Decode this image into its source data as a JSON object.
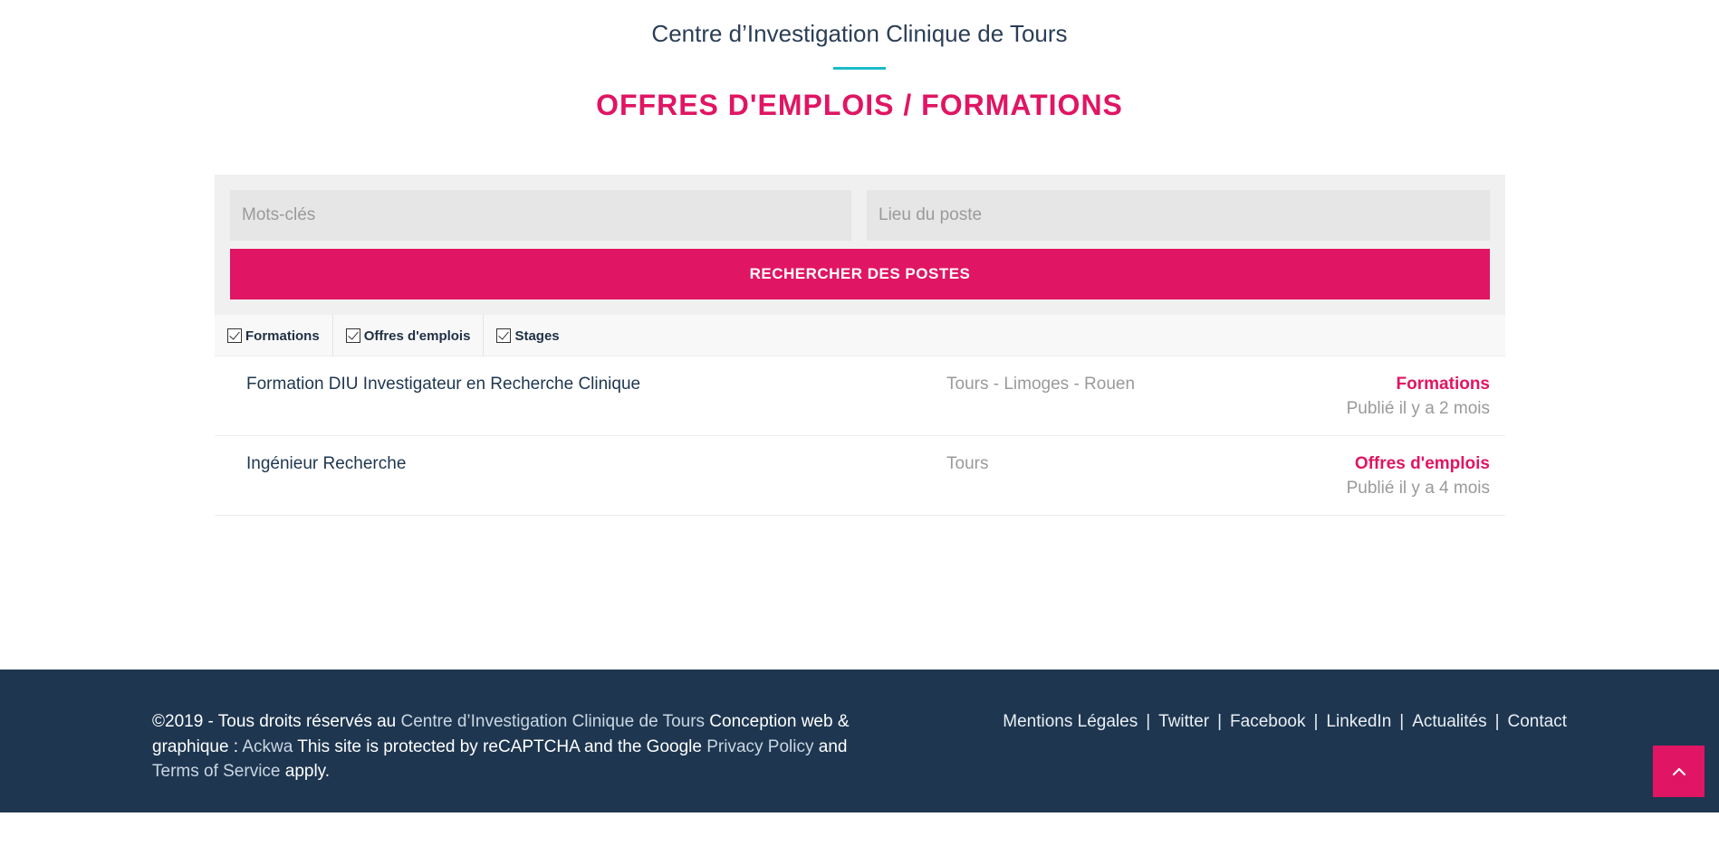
{
  "header": {
    "subtitle": "Centre d’Investigation Clinique de Tours",
    "title": "OFFRES D'EMPLOIS / FORMATIONS"
  },
  "search": {
    "keywords_placeholder": "Mots-clés",
    "keywords_value": "",
    "location_placeholder": "Lieu du poste",
    "location_value": "",
    "button_label": "RECHERCHER DES POSTES"
  },
  "filters": [
    {
      "label": "Formations",
      "checked": true
    },
    {
      "label": "Offres d'emplois",
      "checked": true
    },
    {
      "label": "Stages",
      "checked": true
    }
  ],
  "jobs": [
    {
      "title": "Formation DIU Investigateur en Recherche Clinique",
      "location": "Tours - Limoges - Rouen",
      "type": "Formations",
      "published": "Publié il y a 2 mois"
    },
    {
      "title": "Ingénieur Recherche",
      "location": "Tours",
      "type": "Offres d'emplois",
      "published": "Publié il y a 4 mois"
    }
  ],
  "footer": {
    "copyright_prefix": "©2019 - Tous droits réservés au ",
    "org_link": "Centre d’Investigation Clinique de Tours",
    "design_text": " Conception web & graphique : ",
    "agency_link": "Ackwa",
    "recaptcha_text": " This site is protected by reCAPTCHA and the Google ",
    "privacy_link": "Privacy Policy",
    "and_text": " and ",
    "terms_link": "Terms of Service",
    "apply_text": " apply.",
    "links": [
      "Mentions Légales",
      "Twitter",
      "Facebook",
      "LinkedIn",
      "Actualités",
      "Contact"
    ],
    "separator": "|"
  },
  "back_to_top_icon": "chevron-up-icon",
  "colors": {
    "accent": "#e01563",
    "teal": "#1bbcc7",
    "navy": "#1e3650"
  }
}
